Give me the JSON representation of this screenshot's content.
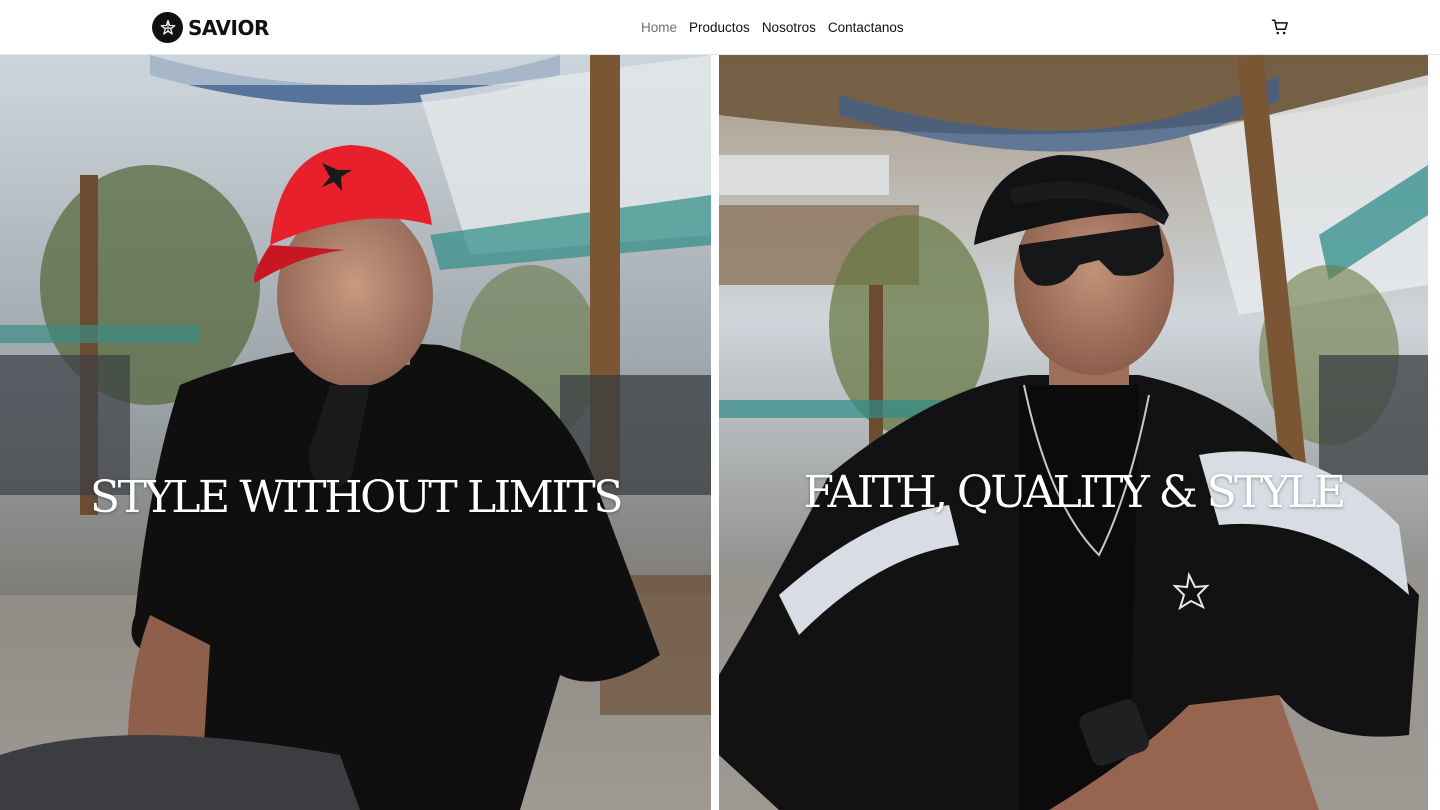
{
  "brand": {
    "name": "SAVIOR",
    "logo_icon": "star-icon"
  },
  "nav": {
    "items": [
      {
        "label": "Home",
        "active": true
      },
      {
        "label": "Productos",
        "active": false
      },
      {
        "label": "Nosotros",
        "active": false
      },
      {
        "label": "Contactanos",
        "active": false
      }
    ]
  },
  "header": {
    "cart_icon": "cart-icon"
  },
  "hero": {
    "panels": [
      {
        "title": "STYLE WITHOUT LIMITS"
      },
      {
        "title": "FAITH, QUALITY & STYLE"
      }
    ]
  },
  "colors": {
    "header_bg": "#ffffff",
    "text": "#111111",
    "nav_active": "#6f6f6f",
    "hero_text": "#ffffff",
    "cap_red": "#e8202c"
  }
}
